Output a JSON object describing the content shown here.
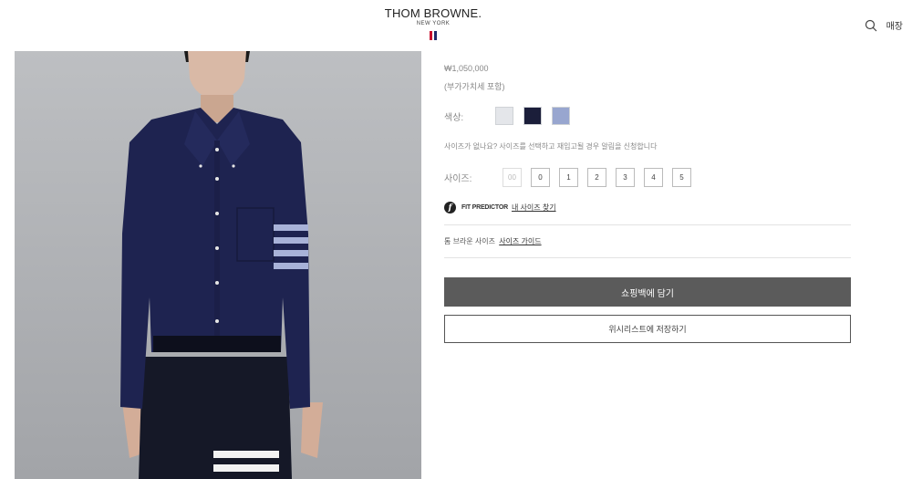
{
  "header": {
    "brand": "THOM BROWNE.",
    "brand_sub": "NEW YORK",
    "flag_colors": [
      "#c8102e",
      "#ffffff",
      "#1f2a6b"
    ],
    "search_icon": "search-icon",
    "store_label": "매장"
  },
  "product": {
    "price": "₩1,050,000",
    "vat_note": "(부가가치세 포함)",
    "color_label": "색상:",
    "colors": [
      "#e4e6ea",
      "#1b1e3a",
      "#98a6cf"
    ],
    "size_hint": "사이즈가 없나요? 사이즈를 선택하고 재입고될 경우 알림을 신청합니다",
    "size_label": "사이즈:",
    "sizes": [
      "00",
      "0",
      "1",
      "2",
      "3",
      "4",
      "5"
    ],
    "fit_brand": "FIT PREDICTOR",
    "fit_link": "내 사이즈 찾기",
    "guide_text": "톰 브라운 사이즈",
    "guide_link": "사이즈 가이드",
    "add_to_bag": "쇼핑백에 담기",
    "add_to_wishlist": "위시리스트에 저장하기"
  }
}
